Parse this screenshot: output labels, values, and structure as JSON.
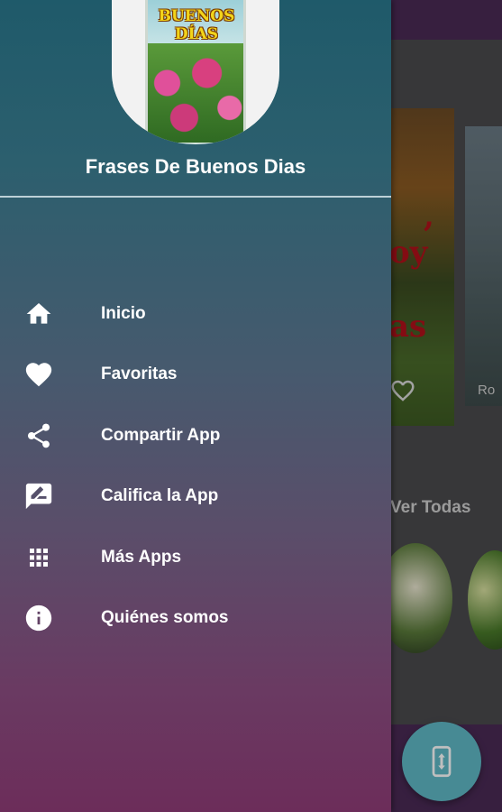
{
  "app": {
    "title": "Frases De Buenos Dias",
    "logo_text_line1": "BUENOS",
    "logo_text_line2": "DÍAS"
  },
  "menu": {
    "items": [
      {
        "label": "Inicio",
        "icon": "home-icon"
      },
      {
        "label": "Favoritas",
        "icon": "heart-icon"
      },
      {
        "label": "Compartir App",
        "icon": "share-icon"
      },
      {
        "label": "Califica la App",
        "icon": "rate-review-icon"
      },
      {
        "label": "Más Apps",
        "icon": "apps-grid-icon"
      },
      {
        "label": "Quiénes somos",
        "icon": "info-icon"
      }
    ]
  },
  "background": {
    "section_link": "Ver Todas",
    "card_label_fragment": "Ro",
    "card_text_fragments": [
      ",",
      "oy",
      "as"
    ]
  },
  "colors": {
    "drawer_top": "#1f5a6a",
    "drawer_bottom": "#6c2d5a",
    "fab": "#5fb9c6",
    "text": "#ffffff"
  }
}
